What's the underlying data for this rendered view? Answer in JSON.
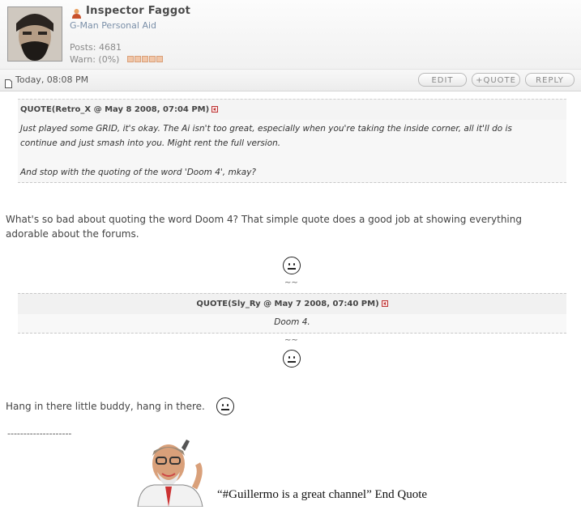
{
  "user": {
    "name": "Inspector Faggot",
    "group": "G-Man Personal Aid",
    "posts": "Posts: 4681",
    "warn": "Warn: (0%)"
  },
  "postbar": {
    "date": "Today, 08:08 PM",
    "edit_label": "EDIT",
    "quote_label": "+QUOTE",
    "reply_label": "REPLY"
  },
  "quote1": {
    "header": "QUOTE(Retro_X @ May 8 2008, 07:04 PM)",
    "line1": "Just played some GRID, it's okay. The Ai isn't too great, especially when you're taking the inside corner, all it'll do is",
    "line2": "continue and just smash into you. Might rent the full version.",
    "line3": "And stop with the quoting of the word 'Doom 4', mkay?"
  },
  "reply": {
    "line1": "What's so bad about quoting the word Doom 4? That simple quote does a good job at showing everything",
    "line2": "adorable about the forums.",
    "tilde": "~~",
    "closing": "Hang in there little buddy, hang in there."
  },
  "quote2": {
    "header": "QUOTE(Sly_Ry @ May 7 2008, 07:40 PM)",
    "body": "Doom 4."
  },
  "signature": {
    "divider": "--------------------",
    "text": "“#Guillermo is a great channel” End Quote"
  }
}
